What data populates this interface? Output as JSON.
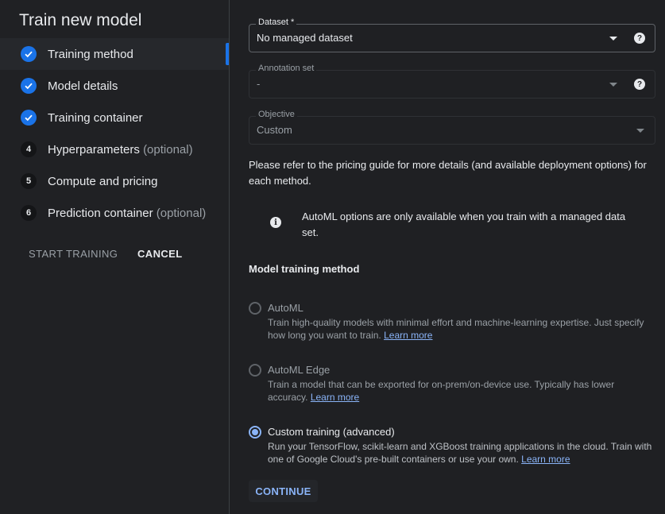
{
  "panel": {
    "title": "Train new model",
    "steps": [
      {
        "label": "Training method",
        "optional": "",
        "status": "done",
        "num": ""
      },
      {
        "label": "Model details",
        "optional": "",
        "status": "done",
        "num": ""
      },
      {
        "label": "Training container",
        "optional": "",
        "status": "done",
        "num": ""
      },
      {
        "label": "Hyperparameters",
        "optional": "(optional)",
        "status": "pending",
        "num": "4"
      },
      {
        "label": "Compute and pricing",
        "optional": "",
        "status": "pending",
        "num": "5"
      },
      {
        "label": "Prediction container",
        "optional": "(optional)",
        "status": "pending",
        "num": "6"
      }
    ],
    "start_label": "START TRAINING",
    "cancel_label": "CANCEL"
  },
  "form": {
    "dataset": {
      "label": "Dataset *",
      "value": "No managed dataset"
    },
    "annotation": {
      "label": "Annotation set",
      "value": "-"
    },
    "objective": {
      "label": "Objective",
      "value": "Custom"
    },
    "pricing_note": "Please refer to the pricing guide for more details (and available deployment options) for each method.",
    "info_text": "AutoML options are only available when you train with a managed data set.",
    "section_title": "Model training method",
    "options": [
      {
        "title": "AutoML",
        "desc": "Train high-quality models with minimal effort and machine-learning expertise. Just specify how long you want to train.",
        "link": "Learn more",
        "selected": false
      },
      {
        "title": "AutoML Edge",
        "desc": "Train a model that can be exported for on-prem/on-device use. Typically has lower accuracy.",
        "link": "Learn more",
        "selected": false
      },
      {
        "title": "Custom training (advanced)",
        "desc": "Run your TensorFlow, scikit-learn and XGBoost training applications in the cloud. Train with one of Google Cloud's pre-built containers or use your own.",
        "link": "Learn more",
        "selected": true
      }
    ],
    "continue_label": "CONTINUE"
  },
  "colors": {
    "accent": "#1a73e8",
    "link": "#8ab4f8",
    "background": "#1f2023"
  },
  "icons": {
    "done": "check-icon",
    "help": "help-icon",
    "info": "info-icon",
    "dropdown": "caret-down-icon"
  }
}
